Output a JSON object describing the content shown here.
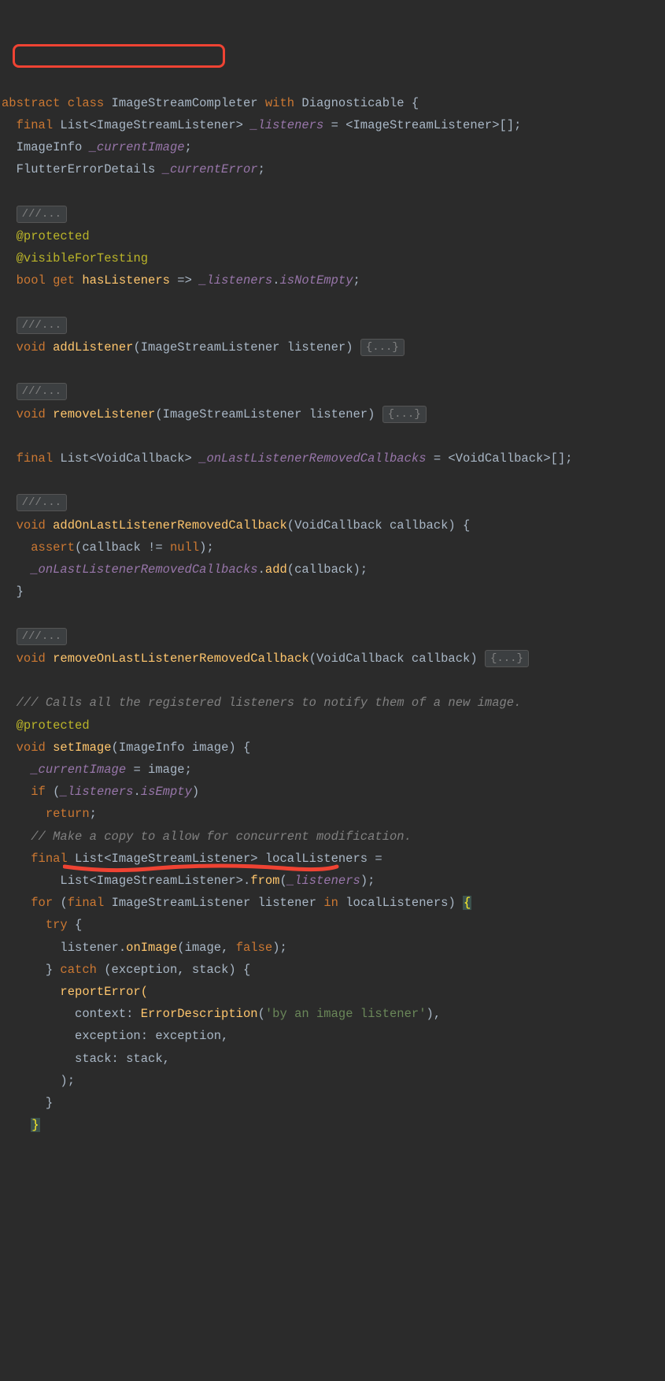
{
  "code": {
    "lines": [
      {
        "indent": 0,
        "segments": [
          [
            "abstract ",
            "k-keyword"
          ],
          [
            "class ",
            "k-keyword"
          ],
          [
            "ImageStreamCompleter ",
            "k-class"
          ],
          [
            "with ",
            "k-keyword"
          ],
          [
            "Diagnosticable ",
            "k-class"
          ],
          [
            "{",
            "k-punct"
          ]
        ]
      },
      {
        "indent": 1,
        "segments": [
          [
            "final ",
            "k-keyword"
          ],
          [
            "List<ImageStreamListener> ",
            "k-class"
          ],
          [
            "_listeners ",
            "k-field"
          ],
          [
            "= <ImageStreamListener>[];",
            "k-punct"
          ]
        ]
      },
      {
        "indent": 1,
        "segments": [
          [
            "ImageInfo ",
            "k-class"
          ],
          [
            "_currentImage",
            "k-field"
          ],
          [
            ";",
            "k-punct"
          ]
        ],
        "highlight": "redbox"
      },
      {
        "indent": 1,
        "segments": [
          [
            "FlutterErrorDetails ",
            "k-class"
          ],
          [
            "_currentError",
            "k-field"
          ],
          [
            ";",
            "k-punct"
          ]
        ]
      },
      {
        "blank": true
      },
      {
        "indent": 1,
        "fold": "///..."
      },
      {
        "indent": 1,
        "segments": [
          [
            "@",
            "k-anno"
          ],
          [
            "protected",
            "k-anno"
          ]
        ]
      },
      {
        "indent": 1,
        "segments": [
          [
            "@",
            "k-anno"
          ],
          [
            "visibleForTesting",
            "k-anno"
          ]
        ]
      },
      {
        "indent": 1,
        "segments": [
          [
            "bool ",
            "k-keyword"
          ],
          [
            "get ",
            "k-keyword"
          ],
          [
            "hasListeners ",
            "k-method"
          ],
          [
            "=> ",
            "k-punct"
          ],
          [
            "_listeners",
            "k-field"
          ],
          [
            ".",
            "k-punct"
          ],
          [
            "isNotEmpty",
            "k-field"
          ],
          [
            ";",
            "k-punct"
          ]
        ]
      },
      {
        "blank": true
      },
      {
        "indent": 1,
        "fold": "///..."
      },
      {
        "indent": 1,
        "segments": [
          [
            "void ",
            "k-keyword"
          ],
          [
            "addListener",
            "k-method"
          ],
          [
            "(ImageStreamListener listener) ",
            "k-punct"
          ]
        ],
        "trailFold": "{...}"
      },
      {
        "blank": true
      },
      {
        "indent": 1,
        "fold": "///..."
      },
      {
        "indent": 1,
        "segments": [
          [
            "void ",
            "k-keyword"
          ],
          [
            "removeListener",
            "k-method"
          ],
          [
            "(ImageStreamListener listener) ",
            "k-punct"
          ]
        ],
        "trailFold": "{...}"
      },
      {
        "blank": true
      },
      {
        "indent": 1,
        "segments": [
          [
            "final ",
            "k-keyword"
          ],
          [
            "List<VoidCallback> ",
            "k-class"
          ],
          [
            "_onLastListenerRemovedCallbacks ",
            "k-field"
          ],
          [
            "= <VoidCallback>[];",
            "k-punct"
          ]
        ]
      },
      {
        "blank": true
      },
      {
        "indent": 1,
        "fold": "///..."
      },
      {
        "indent": 1,
        "segments": [
          [
            "void ",
            "k-keyword"
          ],
          [
            "addOnLastListenerRemovedCallback",
            "k-method"
          ],
          [
            "(VoidCallback callback) {",
            "k-punct"
          ]
        ]
      },
      {
        "indent": 2,
        "segments": [
          [
            "assert",
            "k-keyword"
          ],
          [
            "(callback != ",
            "k-punct"
          ],
          [
            "null",
            "k-literal"
          ],
          [
            ");",
            "k-punct"
          ]
        ]
      },
      {
        "indent": 2,
        "segments": [
          [
            "_onLastListenerRemovedCallbacks",
            "k-field"
          ],
          [
            ".",
            "k-punct"
          ],
          [
            "add",
            "k-method"
          ],
          [
            "(callback);",
            "k-punct"
          ]
        ]
      },
      {
        "indent": 1,
        "segments": [
          [
            "}",
            "k-punct"
          ]
        ]
      },
      {
        "blank": true
      },
      {
        "indent": 1,
        "fold": "///..."
      },
      {
        "indent": 1,
        "segments": [
          [
            "void ",
            "k-keyword"
          ],
          [
            "removeOnLastListenerRemovedCallback",
            "k-method"
          ],
          [
            "(VoidCallback callback) ",
            "k-punct"
          ]
        ],
        "trailFold": "{...}"
      },
      {
        "blank": true
      },
      {
        "indent": 1,
        "segments": [
          [
            "/// Calls all the registered listeners to notify them of a new image.",
            "k-doc"
          ]
        ]
      },
      {
        "indent": 1,
        "segments": [
          [
            "@",
            "k-anno"
          ],
          [
            "protected",
            "k-anno"
          ]
        ]
      },
      {
        "indent": 1,
        "segments": [
          [
            "void ",
            "k-keyword"
          ],
          [
            "setImage",
            "k-method"
          ],
          [
            "(ImageInfo image) {",
            "k-punct"
          ]
        ]
      },
      {
        "indent": 2,
        "segments": [
          [
            "_currentImage ",
            "k-field"
          ],
          [
            "= image;",
            "k-punct"
          ]
        ]
      },
      {
        "indent": 2,
        "segments": [
          [
            "if ",
            "k-keyword"
          ],
          [
            "(",
            "k-punct"
          ],
          [
            "_listeners",
            "k-field"
          ],
          [
            ".",
            "k-punct"
          ],
          [
            "isEmpty",
            "k-field"
          ],
          [
            ")",
            "k-punct"
          ]
        ]
      },
      {
        "indent": 3,
        "segments": [
          [
            "return",
            "k-keyword"
          ],
          [
            ";",
            "k-punct"
          ]
        ]
      },
      {
        "indent": 2,
        "segments": [
          [
            "// Make a copy to allow for concurrent modification.",
            "k-comment"
          ]
        ]
      },
      {
        "indent": 2,
        "segments": [
          [
            "final ",
            "k-keyword"
          ],
          [
            "List<ImageStreamListener> localListeners =",
            "k-class"
          ]
        ]
      },
      {
        "indent": 4,
        "segments": [
          [
            "List<ImageStreamListener>.",
            "k-class"
          ],
          [
            "from",
            "k-method"
          ],
          [
            "(",
            "k-punct"
          ],
          [
            "_listeners",
            "k-field"
          ],
          [
            ");",
            "k-punct"
          ]
        ]
      },
      {
        "indent": 2,
        "segments": [
          [
            "for ",
            "k-keyword"
          ],
          [
            "(",
            "k-punct"
          ],
          [
            "final ",
            "k-keyword"
          ],
          [
            "ImageStreamListener listener ",
            "k-class"
          ],
          [
            "in ",
            "k-keyword"
          ],
          [
            "localListeners) ",
            "k-punct"
          ]
        ],
        "bracketOpen": true
      },
      {
        "indent": 3,
        "segments": [
          [
            "try ",
            "k-keyword"
          ],
          [
            "{",
            "k-punct"
          ]
        ]
      },
      {
        "indent": 4,
        "segments": [
          [
            "listener.",
            "k-punct"
          ],
          [
            "onImage",
            "k-method"
          ],
          [
            "(image",
            "k-punct"
          ],
          [
            ", ",
            "k-punct"
          ],
          [
            "false",
            "k-literal"
          ],
          [
            ");",
            "k-punct"
          ]
        ],
        "underline": true
      },
      {
        "indent": 3,
        "segments": [
          [
            "} ",
            "k-punct"
          ],
          [
            "catch ",
            "k-keyword"
          ],
          [
            "(exception",
            "k-punct"
          ],
          [
            ", ",
            "k-punct"
          ],
          [
            "stack) {",
            "k-punct"
          ]
        ]
      },
      {
        "indent": 4,
        "segments": [
          [
            "reportError(",
            "k-method"
          ]
        ]
      },
      {
        "indent": 5,
        "segments": [
          [
            "context: ",
            "k-paramname"
          ],
          [
            "ErrorDescription",
            "k-method"
          ],
          [
            "(",
            "k-punct"
          ],
          [
            "'by an image listener'",
            "k-string"
          ],
          [
            "),",
            "k-punct"
          ]
        ]
      },
      {
        "indent": 5,
        "segments": [
          [
            "exception: exception",
            "k-paramname"
          ],
          [
            ",",
            "k-punct"
          ]
        ]
      },
      {
        "indent": 5,
        "segments": [
          [
            "stack: stack",
            "k-paramname"
          ],
          [
            ",",
            "k-punct"
          ]
        ]
      },
      {
        "indent": 4,
        "segments": [
          [
            ");",
            "k-punct"
          ]
        ]
      },
      {
        "indent": 3,
        "segments": [
          [
            "}",
            "k-punct"
          ]
        ]
      },
      {
        "indent": 2,
        "bracketClose": true
      }
    ]
  },
  "annotations": {
    "redbox_line_index": 2,
    "redline_line_index": 38
  }
}
